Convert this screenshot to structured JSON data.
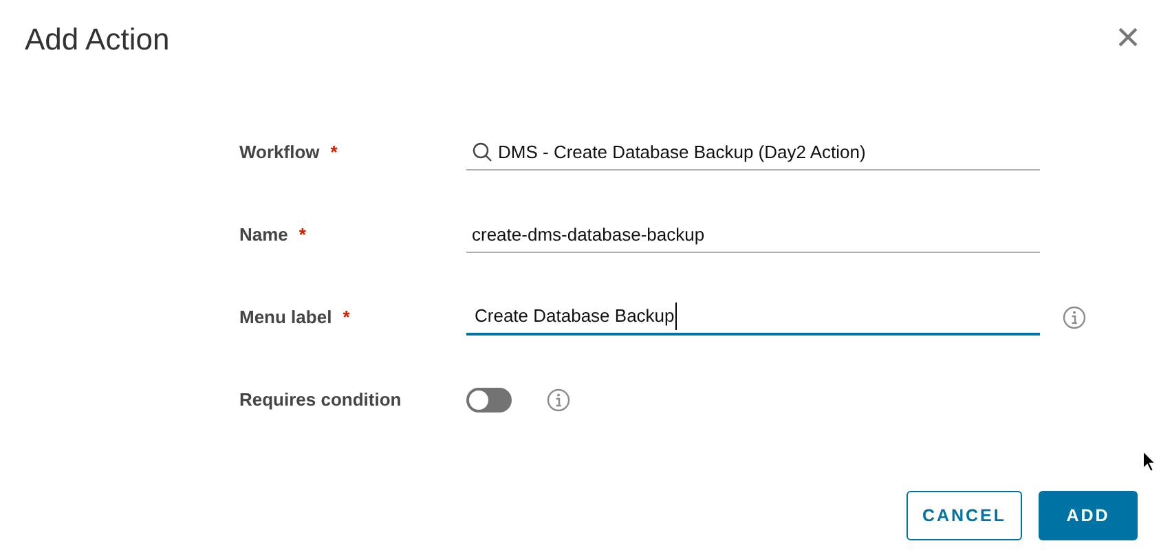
{
  "dialog": {
    "title": "Add Action",
    "close_label": "×"
  },
  "fields": [
    {
      "kind": "search",
      "label": "Workflow",
      "required_mark": "*",
      "value": "DMS - Create Database Backup (Day2 Action)",
      "focused": false,
      "info": false
    },
    {
      "kind": "text",
      "label": "Name",
      "required_mark": "*",
      "value": "create-dms-database-backup",
      "focused": false,
      "info": false
    },
    {
      "kind": "text",
      "label": "Menu label",
      "required_mark": "*",
      "value": "Create Database Backup",
      "focused": true,
      "info": true
    },
    {
      "kind": "toggle",
      "label": "Requires condition",
      "on": false,
      "info": true
    }
  ],
  "buttons": [
    {
      "label": "CANCEL",
      "kind": "secondary"
    },
    {
      "label": "ADD",
      "kind": "primary"
    }
  ]
}
